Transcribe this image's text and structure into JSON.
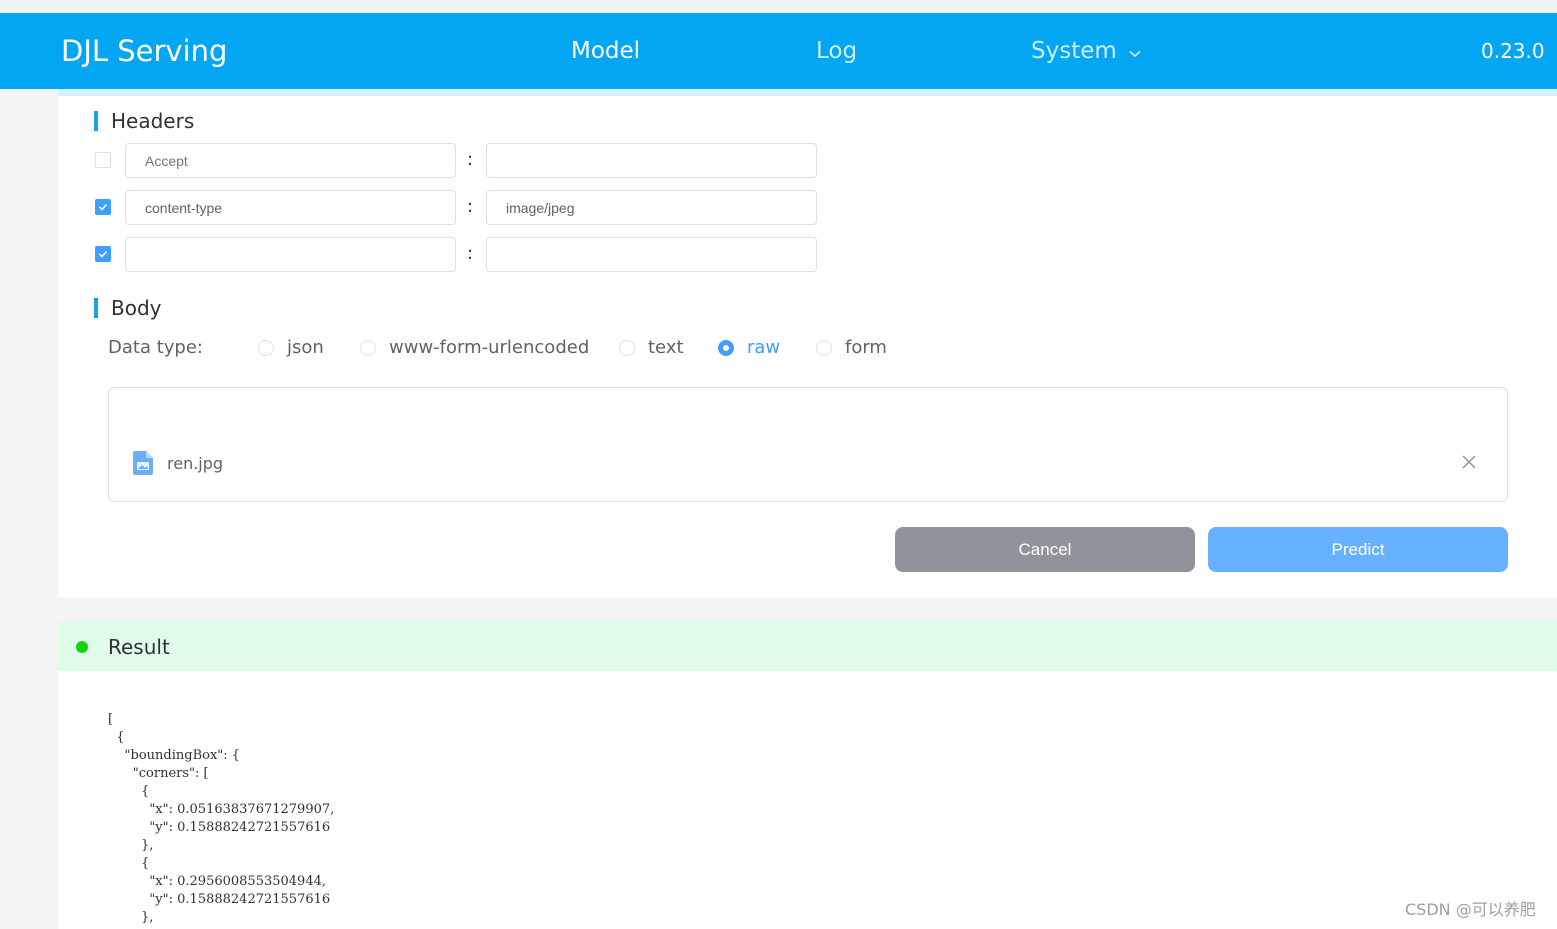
{
  "navbar": {
    "brand": "DJL Serving",
    "items": [
      {
        "label": "Model",
        "active": true
      },
      {
        "label": "Log",
        "active": false
      },
      {
        "label": "System",
        "active": false
      }
    ],
    "version": "0.23.0"
  },
  "headers": {
    "title": "Headers",
    "rows": [
      {
        "checked": false,
        "key_placeholder": "Accept",
        "key": "",
        "value": ""
      },
      {
        "checked": true,
        "key": "content-type",
        "value": "image/jpeg"
      },
      {
        "checked": true,
        "key": "",
        "value": ""
      }
    ],
    "separator": ":"
  },
  "body": {
    "title": "Body",
    "data_type_label": "Data type:",
    "data_types": [
      "json",
      "www-form-urlencoded",
      "text",
      "raw",
      "form"
    ],
    "selected": "raw",
    "file_name": "ren.jpg"
  },
  "buttons": {
    "cancel": "Cancel",
    "predict": "Predict"
  },
  "result": {
    "title": "Result",
    "json_text": "[\n  {\n    \"boundingBox\": {\n      \"corners\": [\n        {\n          \"x\": 0.05163837671279907,\n          \"y\": 0.15888242721557616\n        },\n        {\n          \"x\": 0.2956008553504944,\n          \"y\": 0.15888242721557616\n        },"
  },
  "watermark": "CSDN @可以养肥",
  "colors": {
    "navbar": "#03a6f2",
    "accent": "#409eff",
    "result_bg": "#e1fbea",
    "status_dot": "#18d20f"
  }
}
